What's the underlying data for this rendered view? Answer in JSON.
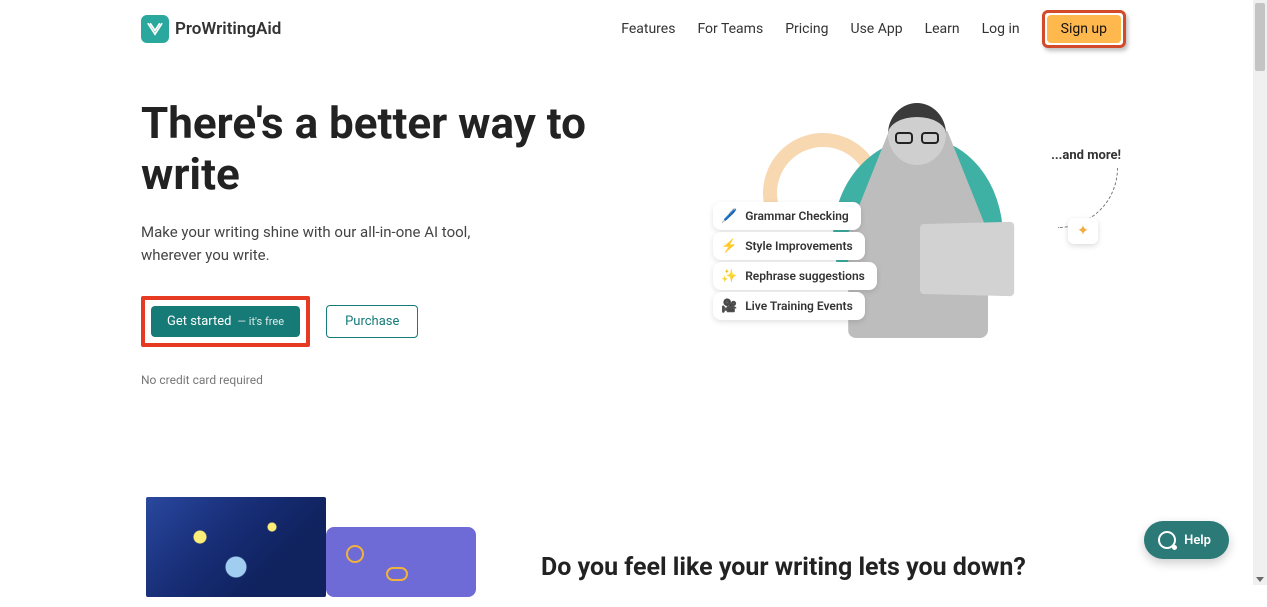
{
  "brand": {
    "name": "ProWritingAid"
  },
  "nav": {
    "features": "Features",
    "for_teams": "For Teams",
    "pricing": "Pricing",
    "use_app": "Use App",
    "learn": "Learn",
    "log_in": "Log in",
    "sign_up": "Sign up"
  },
  "hero": {
    "headline": "There's a better way to write",
    "subhead": "Make your writing shine with our all-in-one AI tool, wherever you write.",
    "get_started_label": "Get started",
    "get_started_sub": "— it's free",
    "purchase_label": "Purchase",
    "disclaimer": "No credit card required"
  },
  "features": {
    "items": [
      {
        "icon": "pen-icon",
        "glyph": "🖊️",
        "label": "Grammar Checking"
      },
      {
        "icon": "bolt-icon",
        "glyph": "⚡",
        "label": "Style Improvements"
      },
      {
        "icon": "wand-icon",
        "glyph": "✨",
        "label": "Rephrase suggestions"
      },
      {
        "icon": "video-icon",
        "glyph": "🎥",
        "label": "Live Training Events"
      }
    ],
    "and_more": "...and more!",
    "sparkle": "✦"
  },
  "section2": {
    "heading": "Do you feel like your writing lets you down?"
  },
  "help": {
    "label": "Help"
  },
  "colors": {
    "accent_teal": "#167a77",
    "accent_orange": "#ffb84d",
    "highlight_red": "#e63b22"
  }
}
